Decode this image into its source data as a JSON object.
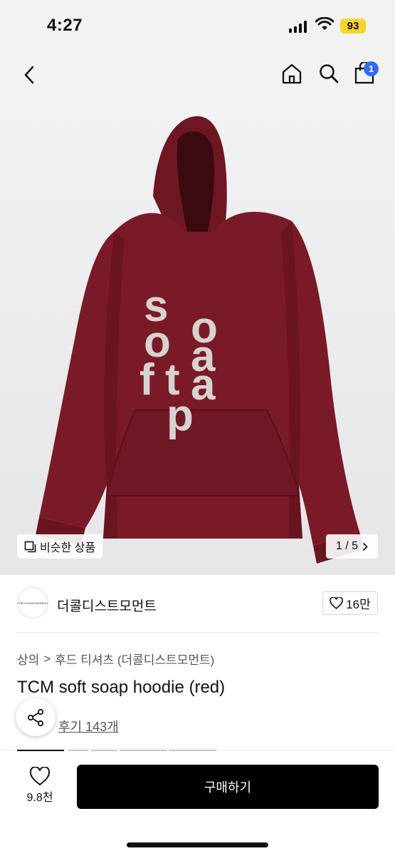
{
  "status_bar": {
    "time": "4:27",
    "battery": "93"
  },
  "nav": {
    "cart_badge": "1"
  },
  "image": {
    "similar_label": "비슷한 상품",
    "page_indicator": "1 / 5",
    "print_letters": [
      "s",
      "o",
      "o",
      "a",
      "f",
      "t",
      "a",
      "p"
    ]
  },
  "shop": {
    "logo_text": "THECOLDISTMOMENT",
    "name": "더콜디스트모먼트",
    "likes": "16만"
  },
  "breadcrumb": {
    "category": "상의",
    "separator": ">",
    "subcategory": "후드 티셔츠 (더콜디스트모먼트)"
  },
  "product": {
    "title": "TCM soft soap hoodie (red)",
    "reviews": "후기 143개"
  },
  "bottom": {
    "wish_count": "9.8천",
    "buy_label": "구매하기"
  },
  "colors": {
    "hoodie": "#7a1a28",
    "print": "#d8d2cf",
    "badge": "#2f6cf6",
    "battery": "#f7d42f"
  }
}
